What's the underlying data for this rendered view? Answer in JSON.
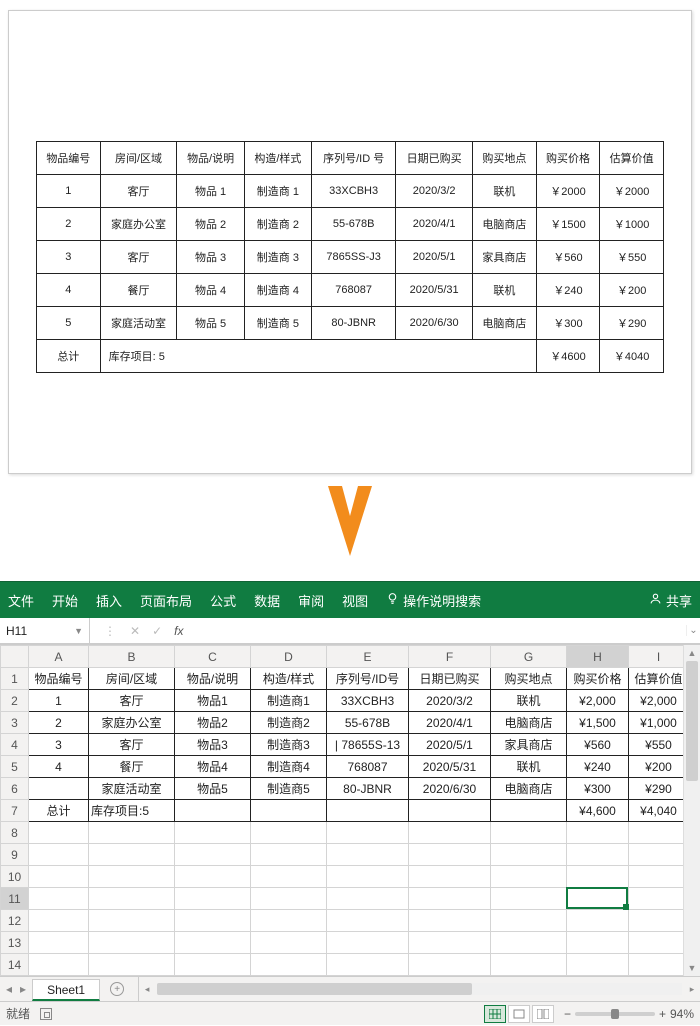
{
  "orig_table": {
    "headers": [
      "物品编号",
      "房间/区域",
      "物品/说明",
      "构造/样式",
      "序列号/ID 号",
      "日期已购买",
      "购买地点",
      "购买价格",
      "估算价值"
    ],
    "rows": [
      [
        "1",
        "客厅",
        "物品 1",
        "制造商 1",
        "33XCBH3",
        "2020/3/2",
        "联机",
        "￥2000",
        "￥2000"
      ],
      [
        "2",
        "家庭办公室",
        "物品 2",
        "制造商 2",
        "55-678B",
        "2020/4/1",
        "电脑商店",
        "￥1500",
        "￥1000"
      ],
      [
        "3",
        "客厅",
        "物品 3",
        "制造商 3",
        "7865SS-J3",
        "2020/5/1",
        "家具商店",
        "￥560",
        "￥550"
      ],
      [
        "4",
        "餐厅",
        "物品 4",
        "制造商 4",
        "768087",
        "2020/5/31",
        "联机",
        "￥240",
        "￥200"
      ],
      [
        "5",
        "家庭活动室",
        "物品 5",
        "制造商 5",
        "80-JBNR",
        "2020/6/30",
        "电脑商店",
        "￥300",
        "￥290"
      ]
    ],
    "total_label": "总计",
    "stock_label": "库存项目: 5",
    "total_price": "￥4600",
    "total_value": "￥4040"
  },
  "ribbon": {
    "tabs": [
      "文件",
      "开始",
      "插入",
      "页面布局",
      "公式",
      "数据",
      "审阅",
      "视图"
    ],
    "tell_me": "操作说明搜索",
    "share": "共享"
  },
  "formula_bar": {
    "name_box": "H11",
    "fx": "fx"
  },
  "sheet": {
    "col_letters": [
      "A",
      "B",
      "C",
      "D",
      "E",
      "F",
      "G",
      "H",
      "I"
    ],
    "row_numbers": [
      "1",
      "2",
      "3",
      "4",
      "5",
      "6",
      "7",
      "8",
      "9",
      "10",
      "11",
      "12",
      "13",
      "14"
    ],
    "header_row": [
      "物品编号",
      "房间/区域",
      "物品/说明",
      "构造/样式",
      "序列号/ID号",
      "日期已购买",
      "购买地点",
      "购买价格",
      "估算价值"
    ],
    "data_rows": [
      [
        "1",
        "客厅",
        "物品1",
        "制造商1",
        "33XCBH3",
        "2020/3/2",
        "联机",
        "¥2,000",
        "¥2,000"
      ],
      [
        "2",
        "家庭办公室",
        "物品2",
        "制造商2",
        "55-678B",
        "2020/4/1",
        "电脑商店",
        "¥1,500",
        "¥1,000"
      ],
      [
        "3",
        "客厅",
        "物品3",
        "制造商3",
        "| 78655S-13",
        "2020/5/1",
        "家具商店",
        "¥560",
        "¥550"
      ],
      [
        "4",
        "餐厅",
        "物品4",
        "制造商4",
        "768087",
        "2020/5/31",
        "联机",
        "¥240",
        "¥200"
      ],
      [
        "",
        "家庭活动室",
        "物品5",
        "制造商5",
        "80-JBNR",
        "2020/6/30",
        "电脑商店",
        "¥300",
        "¥290"
      ]
    ],
    "total_row": [
      "总计",
      "库存项目:5",
      "",
      "",
      "",
      "",
      "",
      "¥4,600",
      "¥4,040"
    ],
    "active_cell": "H11",
    "sheet_name": "Sheet1"
  },
  "statusbar": {
    "ready": "就绪",
    "zoom": "94%"
  }
}
